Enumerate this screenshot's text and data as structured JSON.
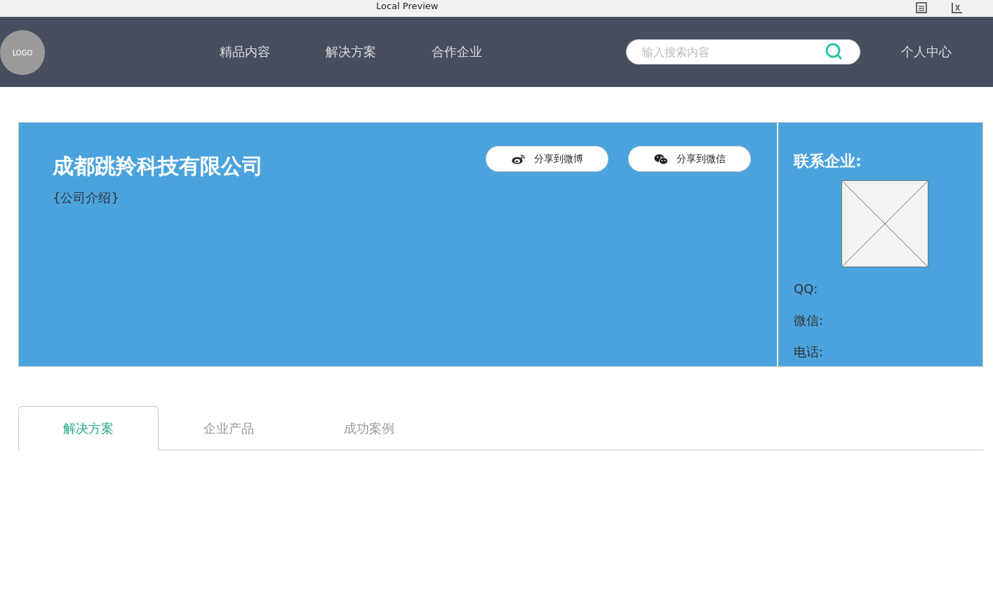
{
  "window": {
    "title": "Local Preview"
  },
  "nav": {
    "logo": "LOGO",
    "items": [
      {
        "label": "精品内容"
      },
      {
        "label": "解决方案"
      },
      {
        "label": "合作企业"
      }
    ],
    "search": {
      "placeholder": "输入搜索内容"
    },
    "user_link": "个人中心"
  },
  "company": {
    "name": "成都跳羚科技有限公司",
    "intro": "{公司介绍}",
    "share_buttons": [
      {
        "kind": "weibo",
        "label": "分享到微博"
      },
      {
        "kind": "wechat",
        "label": "分享到微信"
      }
    ]
  },
  "contact": {
    "heading": "联系企业:",
    "fields": [
      {
        "label": "QQ:"
      },
      {
        "label": "微信:"
      },
      {
        "label": "电话:"
      }
    ]
  },
  "tabs": [
    {
      "label": "解决方案",
      "selected": true
    },
    {
      "label": "企业产品",
      "selected": false
    },
    {
      "label": "成功案例",
      "selected": false
    }
  ]
}
